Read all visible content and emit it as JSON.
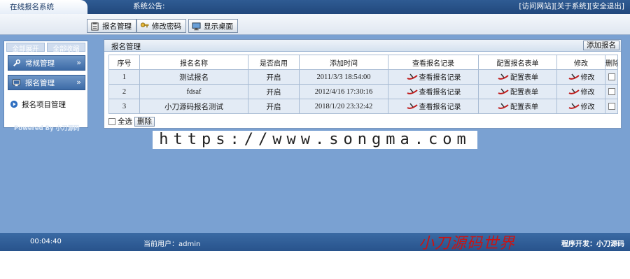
{
  "app": {
    "title": "在线报名系统",
    "notice_label": "系统公告:",
    "top_links": [
      "[访问网站]",
      "[关于系统]",
      "[安全退出]"
    ]
  },
  "toolbar": {
    "buttons": [
      "报名管理",
      "修改密码",
      "显示桌面"
    ]
  },
  "sidebar": {
    "expand_all": "全部展开",
    "collapse_all": "全部收缩",
    "menus": [
      "常规管理",
      "报名管理"
    ],
    "items": [
      "报名项目管理"
    ],
    "powered_by": "Powered By 小刀源码"
  },
  "panel": {
    "title": "报名管理",
    "add_button": "添加报名",
    "columns": [
      "序号",
      "报名名称",
      "是否启用",
      "添加时间",
      "查看报名记录",
      "配置报名表单",
      "修改",
      "删除"
    ],
    "rows": [
      {
        "no": "1",
        "name": "测试报名",
        "enabled": "开启",
        "time": "2011/3/3 18:54:00",
        "view": "查看报名记录",
        "config": "配置表单",
        "edit": "修改"
      },
      {
        "no": "2",
        "name": "fdsaf",
        "enabled": "开启",
        "time": "2012/4/16 17:30:16",
        "view": "查看报名记录",
        "config": "配置表单",
        "edit": "修改"
      },
      {
        "no": "3",
        "name": "小刀源码报名测试",
        "enabled": "开启",
        "time": "2018/1/20 23:32:42",
        "view": "查看报名记录",
        "config": "配置表单",
        "edit": "修改"
      }
    ],
    "select_all": "全选",
    "delete_button": "删除"
  },
  "watermark": "https://www.songma.com",
  "footer": {
    "clock": "00:04:40",
    "current_user": "当前用户：admin",
    "brand": "小刀源码世界",
    "developer": "程序开发：小刀源码"
  },
  "colors": {
    "topbar": "#21487c",
    "body": "#7aa1d2",
    "row": "#e3ebf5",
    "brand": "#c81414"
  }
}
